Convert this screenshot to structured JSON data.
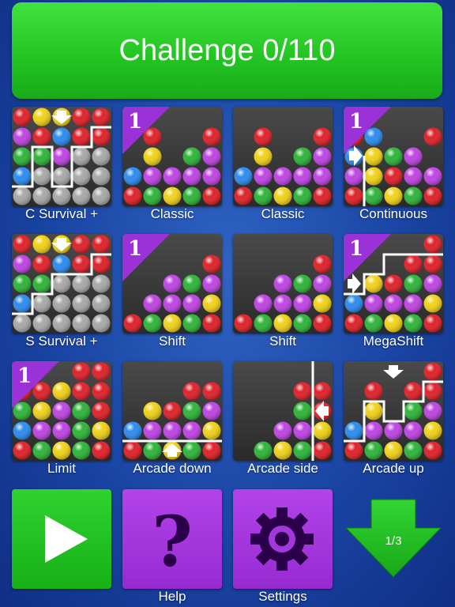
{
  "header": {
    "challenge_label": "Challenge 0/110"
  },
  "modes": [
    {
      "label": "C Survival +",
      "icon": "c-survival-preview-icon"
    },
    {
      "label": "Classic",
      "badge": "1",
      "icon": "classic-preview-icon"
    },
    {
      "label": "Classic",
      "icon": "classic-preview-icon"
    },
    {
      "label": "Continuous",
      "badge": "1",
      "icon": "continuous-preview-icon"
    },
    {
      "label": "S Survival +",
      "icon": "s-survival-preview-icon"
    },
    {
      "label": "Shift",
      "badge": "1",
      "icon": "shift-preview-icon"
    },
    {
      "label": "Shift",
      "icon": "shift-preview-icon"
    },
    {
      "label": "MegaShift",
      "badge": "1",
      "icon": "megashift-preview-icon"
    },
    {
      "label": "Limit",
      "badge": "1",
      "icon": "limit-preview-icon"
    },
    {
      "label": "Arcade down",
      "icon": "arcade-down-preview-icon"
    },
    {
      "label": "Arcade side",
      "icon": "arcade-side-preview-icon"
    },
    {
      "label": "Arcade up",
      "icon": "arcade-up-preview-icon"
    }
  ],
  "bottom": {
    "help_label": "Help",
    "settings_label": "Settings",
    "page_indicator": "1/3"
  },
  "colors": {
    "red": "#e0222a",
    "yellow": "#f1d21a",
    "green": "#2fb53a",
    "purple": "#c045e4",
    "blue": "#2d8cf0",
    "gray": "#a9a9a9",
    "accent_green": "#22c321",
    "accent_purple": "#9b32d8"
  }
}
